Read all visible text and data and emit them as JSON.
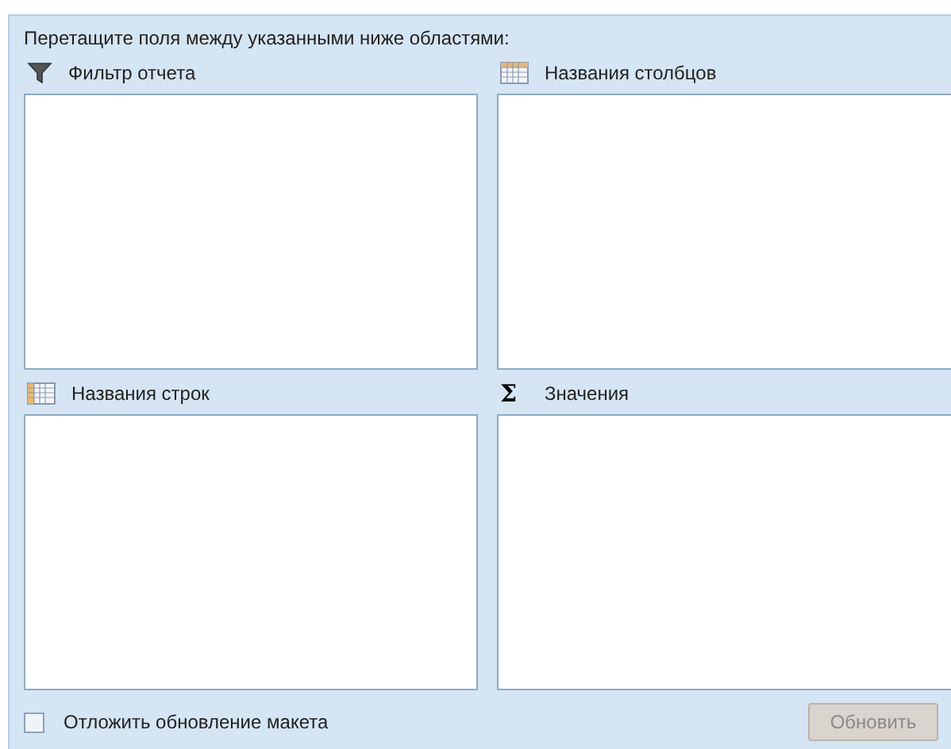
{
  "instruction": "Перетащите поля между указанными ниже областями:",
  "areas": [
    {
      "kind": "filter",
      "label": "Фильтр отчета"
    },
    {
      "kind": "columns",
      "label": "Названия столбцов"
    },
    {
      "kind": "rows",
      "label": "Названия строк"
    },
    {
      "kind": "values",
      "symbol": "Σ",
      "label": "Значения"
    }
  ],
  "defer_update": {
    "label": "Отложить обновление макета",
    "checked": false
  },
  "update_button": {
    "label": "Обновить",
    "disabled": true
  }
}
